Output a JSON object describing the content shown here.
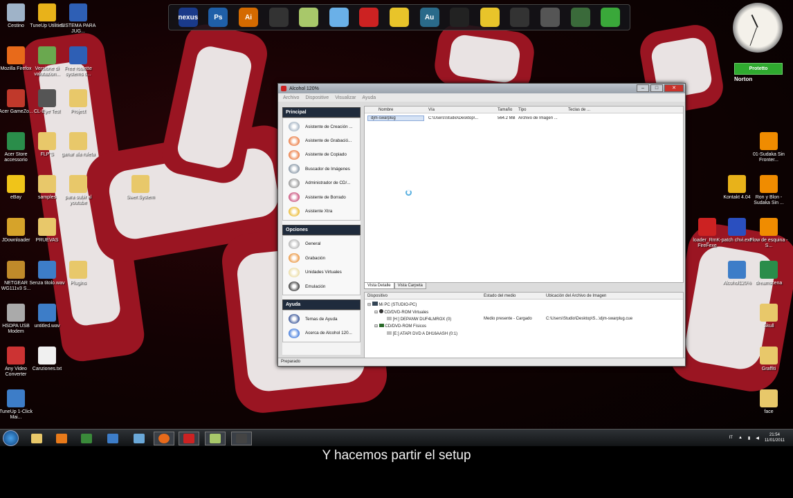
{
  "desktop_icons": [
    {
      "label": "Cestino",
      "icon": "trash-icon",
      "color": "#9fb3c8"
    },
    {
      "label": "TuneUp Utilities",
      "icon": "tuneup-icon",
      "color": "#e8b21a"
    },
    {
      "label": "SISTEMA PARA JUG...",
      "icon": "word-doc-icon",
      "color": "#2e5fb5"
    },
    {
      "label": "Mozilla Firefox",
      "icon": "firefox-icon",
      "color": "#e86a1a"
    },
    {
      "label": "Versione di valutazion...",
      "icon": "app-icon",
      "color": "#6aa84f"
    },
    {
      "label": "Free roulette systems d...",
      "icon": "word-doc-icon",
      "color": "#2e5fb5"
    },
    {
      "label": "Acer GameZo...",
      "icon": "game-icon",
      "color": "#c0392b"
    },
    {
      "label": "CL-Eye Test",
      "icon": "camera-icon",
      "color": "#555555"
    },
    {
      "label": "Project",
      "icon": "folder-icon",
      "color": "#e8c86a"
    },
    {
      "label": "Acer Store accessorio",
      "icon": "store-icon",
      "color": "#2a8d4a"
    },
    {
      "label": "FLP'S",
      "icon": "folder-icon",
      "color": "#e8c86a"
    },
    {
      "label": "ganar ala ruleta",
      "icon": "folder-icon",
      "color": "#e8c86a"
    },
    {
      "label": "eBay",
      "icon": "ebay-icon",
      "color": "#f0c419"
    },
    {
      "label": "samples",
      "icon": "folder-icon",
      "color": "#e8c86a"
    },
    {
      "label": "para subir al youtube",
      "icon": "folder-icon",
      "color": "#e8c86a"
    },
    {
      "label": "Swer.System",
      "icon": "folder-icon",
      "color": "#e8c86a"
    },
    {
      "label": "JDownloader",
      "icon": "jdownloader-icon",
      "color": "#d6a32a"
    },
    {
      "label": "PRUEVAS",
      "icon": "folder-icon",
      "color": "#e8c86a"
    },
    {
      "label": "NETGEAR WG111v3 S...",
      "icon": "network-icon",
      "color": "#c08a2a"
    },
    {
      "label": "Senza titolo.wav",
      "icon": "audio-file-icon",
      "color": "#3d7dc8"
    },
    {
      "label": "Plugins",
      "icon": "folder-icon",
      "color": "#e8c86a"
    },
    {
      "label": "HSDPA USB Modem",
      "icon": "modem-icon",
      "color": "#aaaaaa"
    },
    {
      "label": "untitled.wav",
      "icon": "audio-file-icon",
      "color": "#3d7dc8"
    },
    {
      "label": "Any Video Converter",
      "icon": "converter-icon",
      "color": "#cc3333"
    },
    {
      "label": "Canziones.txt",
      "icon": "text-file-icon",
      "color": "#f0f0f0"
    },
    {
      "label": "TuneUp 1-Click Mai...",
      "icon": "tuneup-icon",
      "color": "#3d7dc8"
    },
    {
      "label": "01-Sudaka Sin Fronter...",
      "icon": "vlc-icon",
      "color": "#f08c00"
    },
    {
      "label": "Kontakt 4.04",
      "icon": "kontakt-icon",
      "color": "#e8b21a"
    },
    {
      "label": "Ron y Blon - Sudaka Sin ...",
      "icon": "vlc-icon",
      "color": "#f08c00"
    },
    {
      "label": "loader_RmK-FireFexe",
      "icon": "alcohol-icon",
      "color": "#cc2222"
    },
    {
      "label": "patch chvi.exe",
      "icon": "alcohol-icon",
      "color": "#2a4fbf"
    },
    {
      "label": "Flow de esquina - S...",
      "icon": "vlc-icon",
      "color": "#f08c00"
    },
    {
      "label": "Alcohol120%",
      "icon": "alcohol-icon",
      "color": "#3d7dc8"
    },
    {
      "label": "dreamscena",
      "icon": "folder-icon",
      "color": "#2a8d4a"
    },
    {
      "label": "Skull",
      "icon": "folder-icon",
      "color": "#e8c86a"
    },
    {
      "label": "Graffiti",
      "icon": "folder-icon",
      "color": "#e8c86a"
    },
    {
      "label": "face",
      "icon": "folder-icon",
      "color": "#e8c86a"
    }
  ],
  "dock": [
    {
      "label": "nexus",
      "icon": "nexus-icon",
      "color": "#1a3a8a"
    },
    {
      "label": "Ps",
      "icon": "photoshop-icon",
      "color": "#1f5fa8"
    },
    {
      "label": "Ai",
      "icon": "illustrator-icon",
      "color": "#d46a00"
    },
    {
      "label": "",
      "icon": "camera-icon",
      "color": "#333333"
    },
    {
      "label": "",
      "icon": "notes-icon",
      "color": "#a8c86a"
    },
    {
      "label": "",
      "icon": "itunes-icon",
      "color": "#6ab0e8"
    },
    {
      "label": "",
      "icon": "flash-icon",
      "color": "#c22"
    },
    {
      "label": "",
      "icon": "fl-studio-icon",
      "color": "#e8c42a"
    },
    {
      "label": "Au",
      "icon": "audition-icon",
      "color": "#2a6a8a"
    },
    {
      "label": "",
      "icon": "circle-app-icon",
      "color": "#222222"
    },
    {
      "label": "",
      "icon": "fl-studio-icon",
      "color": "#e8c42a"
    },
    {
      "label": "",
      "icon": "fl-logo-icon",
      "color": "#333333"
    },
    {
      "label": "",
      "icon": "triangle-app-icon",
      "color": "#555555"
    },
    {
      "label": "",
      "icon": "money-icon",
      "color": "#3a6a3a"
    },
    {
      "label": "",
      "icon": "sims-icon",
      "color": "#3aa83a"
    }
  ],
  "norton": {
    "status": "Protetto",
    "brand": "Norton"
  },
  "alcohol": {
    "title": "Alcohol 120%",
    "menu": [
      "Archivo",
      "Dispositive",
      "Visualizar",
      "Ayuda"
    ],
    "sections": [
      {
        "header": "Principal",
        "items": [
          {
            "label": "Asistente de Creación ...",
            "icon": "create-image-icon",
            "color": "#9ab"
          },
          {
            "label": "Asistente de Grabació...",
            "icon": "burn-icon",
            "color": "#e86a2a"
          },
          {
            "label": "Asistente de Copiado",
            "icon": "copy-disc-icon",
            "color": "#e86a2a"
          },
          {
            "label": "Buscador de Imágenes",
            "icon": "image-search-icon",
            "color": "#789"
          },
          {
            "label": "Administrador de CD/...",
            "icon": "cd-manager-icon",
            "color": "#888"
          },
          {
            "label": "Asistente de Borrado",
            "icon": "erase-icon",
            "color": "#c23a6a"
          },
          {
            "label": "Asistente Xtra",
            "icon": "xtra-icon",
            "color": "#e8b21a"
          }
        ]
      },
      {
        "header": "Opciones",
        "items": [
          {
            "label": "General",
            "icon": "general-icon",
            "color": "#aaa"
          },
          {
            "label": "Grabación",
            "icon": "recording-icon",
            "color": "#e88a2a"
          },
          {
            "label": "Unidades Virtuales",
            "icon": "virtual-drive-icon",
            "color": "#e8d89a"
          },
          {
            "label": "Emulación",
            "icon": "emulation-icon",
            "color": "#222"
          }
        ]
      },
      {
        "header": "Ayuda",
        "items": [
          {
            "label": "Temas de Ayuda",
            "icon": "help-topics-icon",
            "color": "#1f3f8a"
          },
          {
            "label": "Acerca de Alcohol 120...",
            "icon": "info-icon",
            "color": "#2a6ad8"
          }
        ]
      }
    ],
    "file_columns": [
      "Nombre",
      "Vía",
      "Tamaño",
      "Tipo",
      "Teclas de ..."
    ],
    "files": [
      {
        "name": "djm-swarplug",
        "path": "C:\\Users\\Studio\\Desktop\\...",
        "size": "564.2 MB",
        "type": "Archivo de Imagen ..."
      }
    ],
    "tabs": [
      "Vista Detalle",
      "Vista Carpeta"
    ],
    "device_columns": [
      "Dispositivo",
      "Estado del medio",
      "Ubicación del Archivo de Imagen"
    ],
    "devices": {
      "root": "Mi PC (STUDIO-PC)",
      "virtual_group": "CD/DVD-ROM Virtuales",
      "virtual_drive": "[H:] DEPANW DUF4LMROX (0)",
      "virtual_status": "Medio presente - Cargado",
      "virtual_location": "C:\\Users\\Studio\\Desktop\\S...\\djm-swarplug.cue",
      "physical_group": "CD/DVD-ROM Físicos",
      "physical_drive": "[E:] ATAPI DVD A  DH16AASH (0:1)"
    },
    "status": "Preparado"
  },
  "tray": {
    "lang": "IT",
    "time": "21:54",
    "date": "11/01/2011"
  },
  "subtitle": "Y hacemos partir el setup"
}
